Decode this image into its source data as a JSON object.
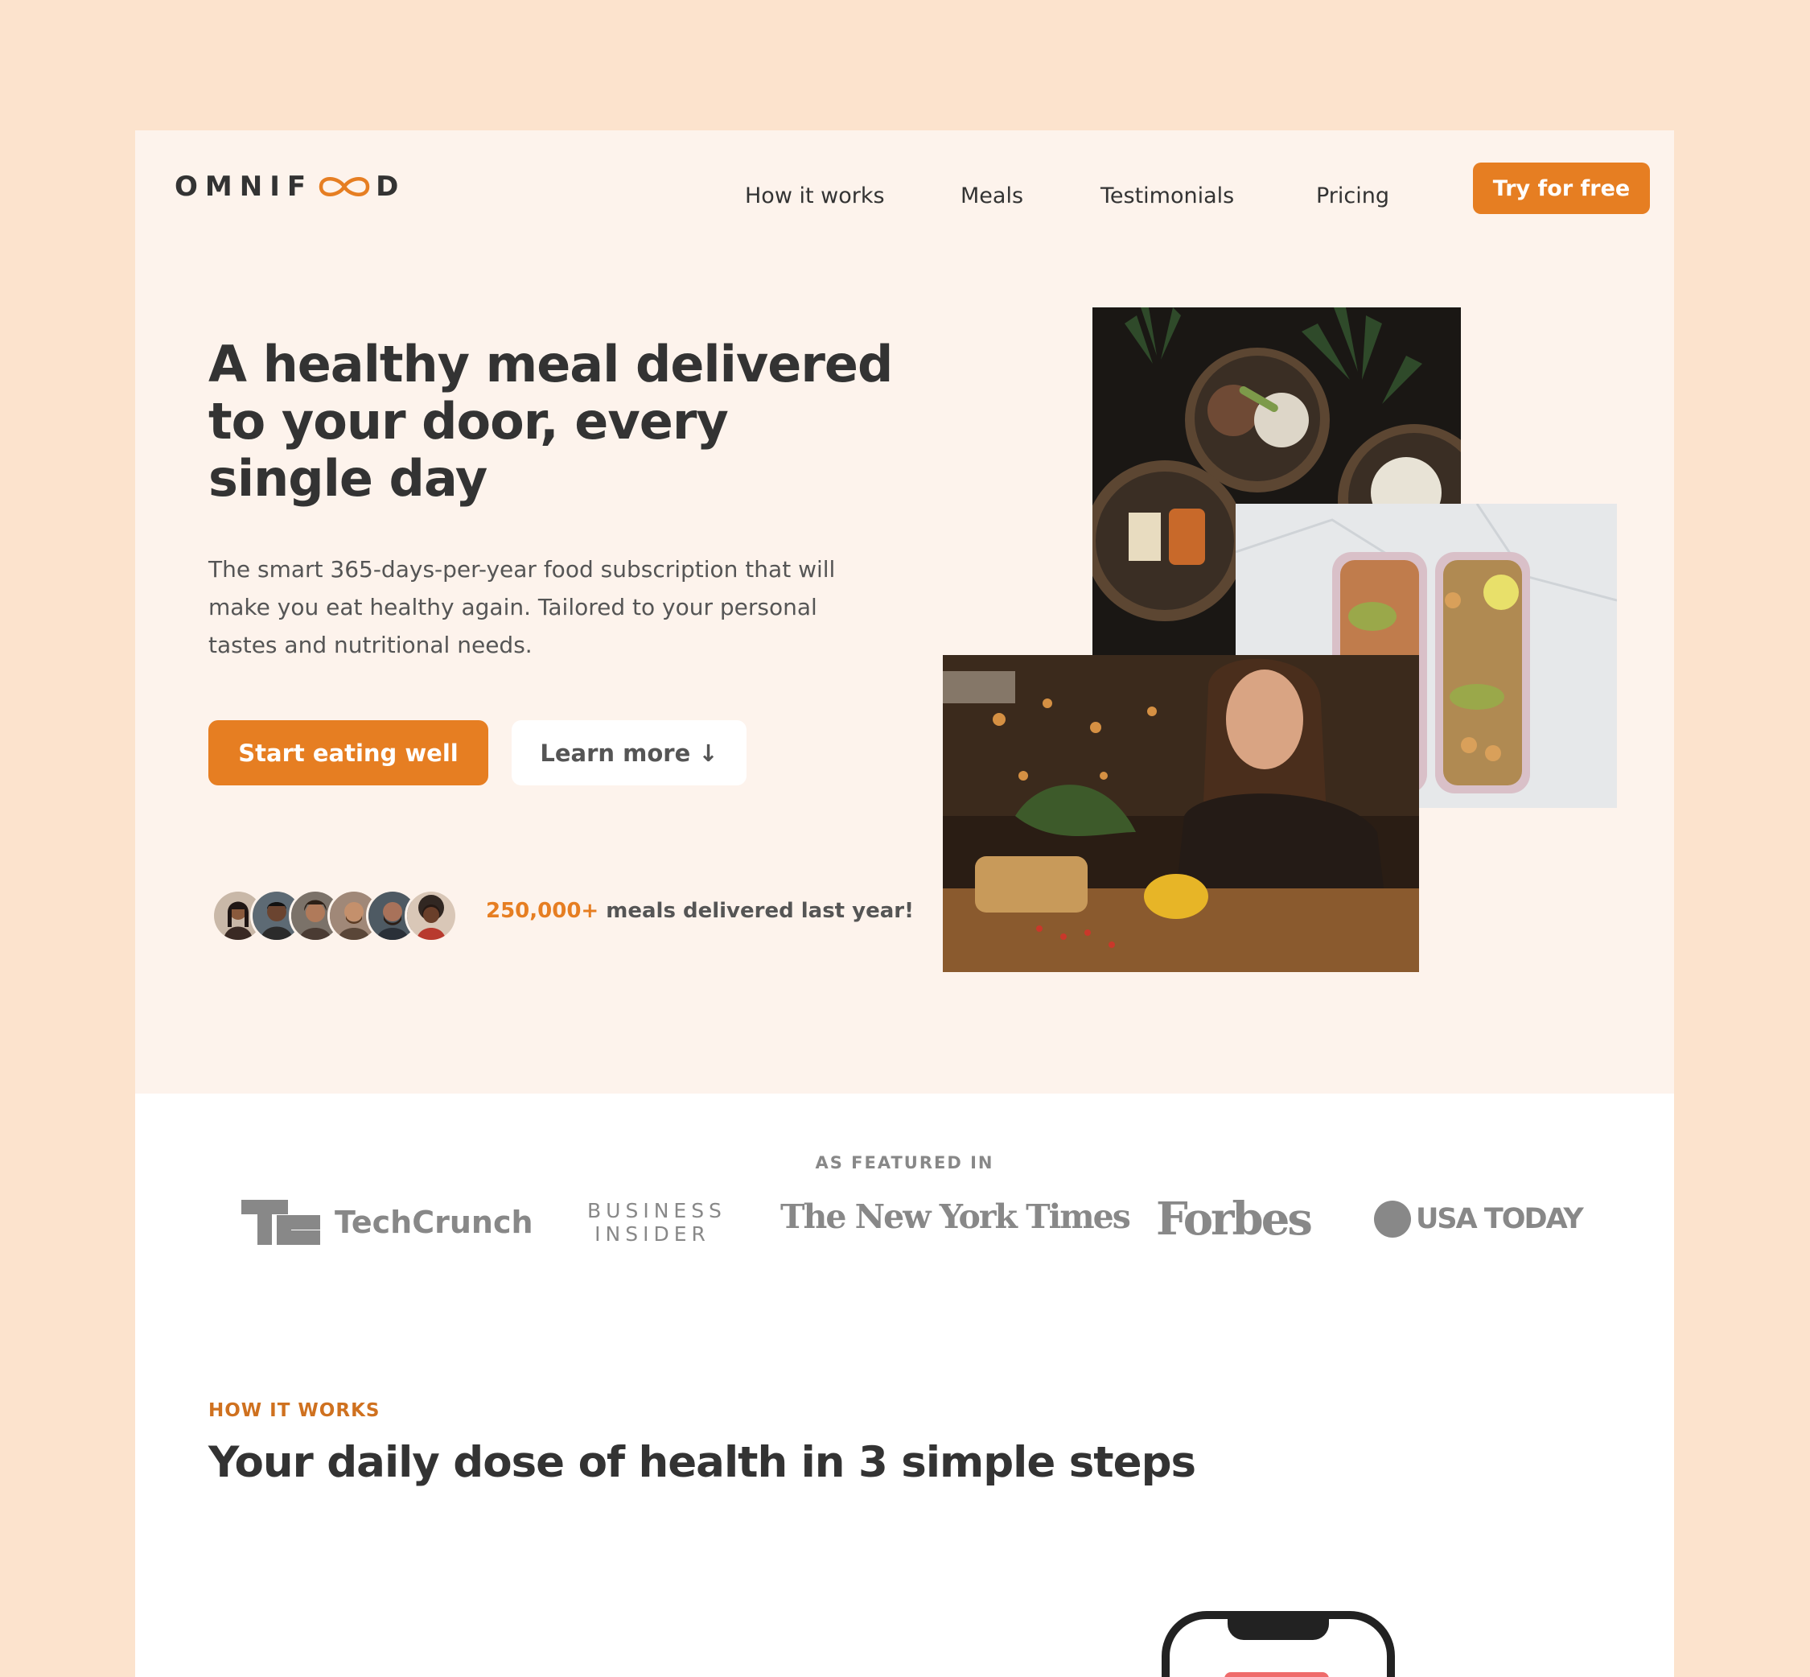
{
  "header": {
    "logo_text_left": "OMNIF",
    "logo_text_right": "D",
    "nav_links": [
      "How it works",
      "Meals",
      "Testimonials",
      "Pricing"
    ],
    "cta_label": "Try for free"
  },
  "hero": {
    "title": "A healthy meal delivered to your door, every single day",
    "description": "The smart 365-days-per-year food subscription that will make you eat healthy again. Tailored to your personal tastes and nutritional needs.",
    "primary_button": "Start eating well",
    "secondary_button": "Learn more ↓",
    "delivered_highlight": "250,000+",
    "delivered_text": " meals delivered last year!"
  },
  "featured": {
    "label": "AS FEATURED IN",
    "logos": [
      "TechCrunch",
      "BUSINESS",
      "INSIDER",
      "The New York Times",
      "Forbes",
      "USA TODAY"
    ]
  },
  "how_it_works": {
    "subheading": "HOW IT WORKS",
    "heading": "Your daily dose of health in 3 simple steps"
  },
  "colors": {
    "accent": "#e67e22",
    "page_bg": "#fce3cd",
    "hero_bg": "#fdf3ec"
  }
}
